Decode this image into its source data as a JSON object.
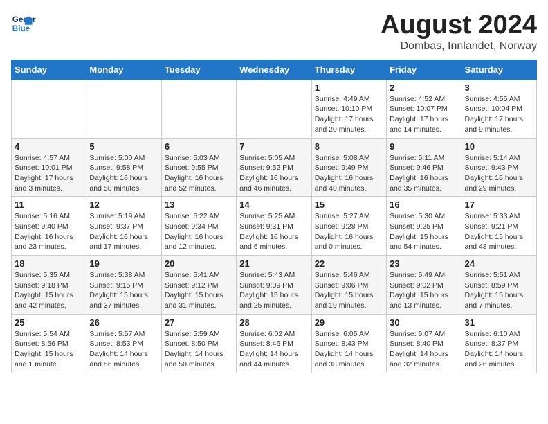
{
  "logo": {
    "line1": "General",
    "line2": "Blue"
  },
  "title": {
    "month_year": "August 2024",
    "location": "Dombas, Innlandet, Norway"
  },
  "weekdays": [
    "Sunday",
    "Monday",
    "Tuesday",
    "Wednesday",
    "Thursday",
    "Friday",
    "Saturday"
  ],
  "weeks": [
    [
      {
        "day": "",
        "info": ""
      },
      {
        "day": "",
        "info": ""
      },
      {
        "day": "",
        "info": ""
      },
      {
        "day": "",
        "info": ""
      },
      {
        "day": "1",
        "info": "Sunrise: 4:49 AM\nSunset: 10:10 PM\nDaylight: 17 hours\nand 20 minutes."
      },
      {
        "day": "2",
        "info": "Sunrise: 4:52 AM\nSunset: 10:07 PM\nDaylight: 17 hours\nand 14 minutes."
      },
      {
        "day": "3",
        "info": "Sunrise: 4:55 AM\nSunset: 10:04 PM\nDaylight: 17 hours\nand 9 minutes."
      }
    ],
    [
      {
        "day": "4",
        "info": "Sunrise: 4:57 AM\nSunset: 10:01 PM\nDaylight: 17 hours\nand 3 minutes."
      },
      {
        "day": "5",
        "info": "Sunrise: 5:00 AM\nSunset: 9:58 PM\nDaylight: 16 hours\nand 58 minutes."
      },
      {
        "day": "6",
        "info": "Sunrise: 5:03 AM\nSunset: 9:55 PM\nDaylight: 16 hours\nand 52 minutes."
      },
      {
        "day": "7",
        "info": "Sunrise: 5:05 AM\nSunset: 9:52 PM\nDaylight: 16 hours\nand 46 minutes."
      },
      {
        "day": "8",
        "info": "Sunrise: 5:08 AM\nSunset: 9:49 PM\nDaylight: 16 hours\nand 40 minutes."
      },
      {
        "day": "9",
        "info": "Sunrise: 5:11 AM\nSunset: 9:46 PM\nDaylight: 16 hours\nand 35 minutes."
      },
      {
        "day": "10",
        "info": "Sunrise: 5:14 AM\nSunset: 9:43 PM\nDaylight: 16 hours\nand 29 minutes."
      }
    ],
    [
      {
        "day": "11",
        "info": "Sunrise: 5:16 AM\nSunset: 9:40 PM\nDaylight: 16 hours\nand 23 minutes."
      },
      {
        "day": "12",
        "info": "Sunrise: 5:19 AM\nSunset: 9:37 PM\nDaylight: 16 hours\nand 17 minutes."
      },
      {
        "day": "13",
        "info": "Sunrise: 5:22 AM\nSunset: 9:34 PM\nDaylight: 16 hours\nand 12 minutes."
      },
      {
        "day": "14",
        "info": "Sunrise: 5:25 AM\nSunset: 9:31 PM\nDaylight: 16 hours\nand 6 minutes."
      },
      {
        "day": "15",
        "info": "Sunrise: 5:27 AM\nSunset: 9:28 PM\nDaylight: 16 hours\nand 0 minutes."
      },
      {
        "day": "16",
        "info": "Sunrise: 5:30 AM\nSunset: 9:25 PM\nDaylight: 15 hours\nand 54 minutes."
      },
      {
        "day": "17",
        "info": "Sunrise: 5:33 AM\nSunset: 9:21 PM\nDaylight: 15 hours\nand 48 minutes."
      }
    ],
    [
      {
        "day": "18",
        "info": "Sunrise: 5:35 AM\nSunset: 9:18 PM\nDaylight: 15 hours\nand 42 minutes."
      },
      {
        "day": "19",
        "info": "Sunrise: 5:38 AM\nSunset: 9:15 PM\nDaylight: 15 hours\nand 37 minutes."
      },
      {
        "day": "20",
        "info": "Sunrise: 5:41 AM\nSunset: 9:12 PM\nDaylight: 15 hours\nand 31 minutes."
      },
      {
        "day": "21",
        "info": "Sunrise: 5:43 AM\nSunset: 9:09 PM\nDaylight: 15 hours\nand 25 minutes."
      },
      {
        "day": "22",
        "info": "Sunrise: 5:46 AM\nSunset: 9:06 PM\nDaylight: 15 hours\nand 19 minutes."
      },
      {
        "day": "23",
        "info": "Sunrise: 5:49 AM\nSunset: 9:02 PM\nDaylight: 15 hours\nand 13 minutes."
      },
      {
        "day": "24",
        "info": "Sunrise: 5:51 AM\nSunset: 8:59 PM\nDaylight: 15 hours\nand 7 minutes."
      }
    ],
    [
      {
        "day": "25",
        "info": "Sunrise: 5:54 AM\nSunset: 8:56 PM\nDaylight: 15 hours\nand 1 minute."
      },
      {
        "day": "26",
        "info": "Sunrise: 5:57 AM\nSunset: 8:53 PM\nDaylight: 14 hours\nand 56 minutes."
      },
      {
        "day": "27",
        "info": "Sunrise: 5:59 AM\nSunset: 8:50 PM\nDaylight: 14 hours\nand 50 minutes."
      },
      {
        "day": "28",
        "info": "Sunrise: 6:02 AM\nSunset: 8:46 PM\nDaylight: 14 hours\nand 44 minutes."
      },
      {
        "day": "29",
        "info": "Sunrise: 6:05 AM\nSunset: 8:43 PM\nDaylight: 14 hours\nand 38 minutes."
      },
      {
        "day": "30",
        "info": "Sunrise: 6:07 AM\nSunset: 8:40 PM\nDaylight: 14 hours\nand 32 minutes."
      },
      {
        "day": "31",
        "info": "Sunrise: 6:10 AM\nSunset: 8:37 PM\nDaylight: 14 hours\nand 26 minutes."
      }
    ]
  ]
}
